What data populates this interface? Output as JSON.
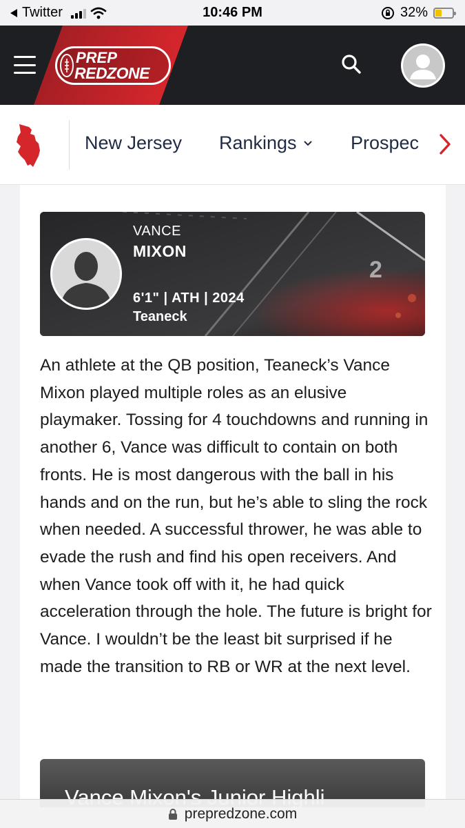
{
  "status_bar": {
    "back_app": "Twitter",
    "time": "10:46 PM",
    "battery": "32%"
  },
  "header": {
    "logo_line1": "PREP",
    "logo_line2": "REDZONE"
  },
  "subnav": {
    "items": [
      {
        "label": "New Jersey"
      },
      {
        "label": "Rankings"
      },
      {
        "label": "Prospec"
      }
    ]
  },
  "profile": {
    "first_name": "VANCE",
    "last_name": "MIXON",
    "meta": "6'1\" | ATH | 2024",
    "school": "Teaneck"
  },
  "article": {
    "body": "An athlete at the QB position, Teaneck’s Vance Mixon played multiple roles as an elusive playmaker. Tossing for 4 touchdowns and running in another 6, Vance was difficult to contain on both fronts. He is most dangerous with the ball in his hands and on the run, but he’s able to sling the rock when needed. A successful thrower, he was able to evade the rush and find his open receivers. And when Vance took off with it, he had quick acceleration through the hole. The future is bright for Vance. I wouldn’t be the least bit surprised if he made the transition to RB or WR at the next level."
  },
  "video": {
    "title": "Vance Mixon's Junior Highli"
  },
  "urlbar": {
    "domain": "prepredzone.com"
  },
  "colors": {
    "brand_red": "#d5262c",
    "header_dark": "#1e1f22",
    "nav_text": "#1f2a44"
  }
}
